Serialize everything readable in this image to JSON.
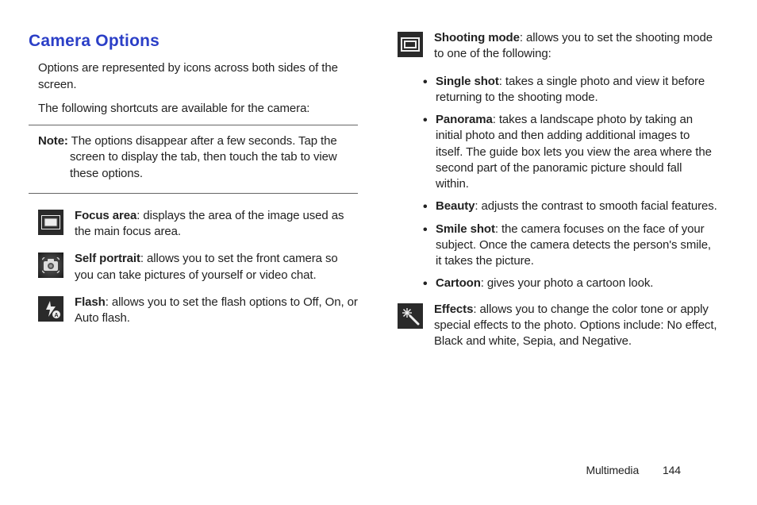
{
  "title": "Camera Options",
  "intro1": "Options are represented by icons across both sides of the screen.",
  "intro2": "The following shortcuts are available for the camera:",
  "note_label": "Note:",
  "note_text": "The options disappear after a few seconds. Tap the screen to display the tab, then touch the tab to view these options.",
  "left_items": [
    {
      "label": "Focus area",
      "text": ": displays the area of the image used as the main focus area."
    },
    {
      "label": "Self portrait",
      "text": ": allows you to set the front camera so you can take pictures of yourself or video chat."
    },
    {
      "label": "Flash",
      "text": ": allows you to set the flash options to Off, On, or Auto flash."
    }
  ],
  "shooting": {
    "label": "Shooting mode",
    "text": ": allows you to set the shooting mode to one of the following:",
    "modes": [
      {
        "label": "Single shot",
        "text": ": takes a single photo and view it before returning to the shooting mode."
      },
      {
        "label": "Panorama",
        "text": ": takes a landscape photo by taking an initial photo and then adding additional images to itself. The guide box lets you view the area where the second part of the panoramic picture should fall within."
      },
      {
        "label": "Beauty",
        "text": ": adjusts the contrast to smooth facial features."
      },
      {
        "label": "Smile shot",
        "text": ": the camera focuses on the face of your subject. Once the camera detects the person's smile, it takes the picture."
      },
      {
        "label": "Cartoon",
        "text": ": gives your photo a cartoon look."
      }
    ]
  },
  "effects": {
    "label": "Effects",
    "text": ": allows you to change the color tone or apply special effects to the photo. Options include: No effect, Black and white, Sepia, and Negative."
  },
  "footer_section": "Multimedia",
  "footer_page": "144"
}
